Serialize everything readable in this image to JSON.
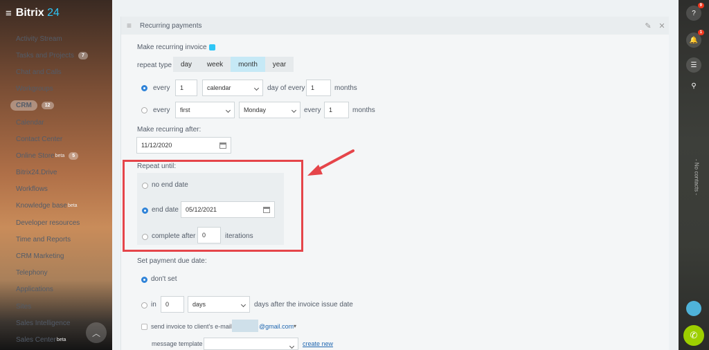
{
  "app": {
    "logo_main": "Bitrix",
    "logo_accent": "24"
  },
  "sidebar": {
    "items": [
      {
        "label": "Activity Stream"
      },
      {
        "label": "Tasks and Projects",
        "counter": "7"
      },
      {
        "label": "Chat and Calls"
      },
      {
        "label": "Workgroups"
      },
      {
        "label": "CRM",
        "counter": "12",
        "active": true
      },
      {
        "label": "Calendar"
      },
      {
        "label": "Contact Center"
      },
      {
        "label": "Online Store",
        "sup": "beta",
        "counter": "5"
      },
      {
        "label": "Bitrix24.Drive"
      },
      {
        "label": "Workflows"
      },
      {
        "label": "Knowledge base",
        "sup": "beta"
      },
      {
        "label": "Developer resources"
      },
      {
        "label": "Time and Reports"
      },
      {
        "label": "CRM Marketing"
      },
      {
        "label": "Telephony"
      },
      {
        "label": "Applications"
      },
      {
        "label": "Sites"
      },
      {
        "label": "Sales Intelligence"
      },
      {
        "label": "Sales Center",
        "sup": "beta"
      }
    ]
  },
  "panel": {
    "title": "Recurring payments",
    "make_recurring_label": "Make recurring invoice",
    "repeat_type_label": "repeat type",
    "repeat_types": [
      "day",
      "week",
      "month",
      "year"
    ],
    "selected_repeat_type": "month",
    "row1": {
      "every": "every",
      "value": "1",
      "mode": "calendar",
      "day_of_every": "day of every",
      "months_value": "1",
      "months": "months"
    },
    "row2": {
      "every": "every",
      "ordinal": "first",
      "weekday": "Monday",
      "every2": "every",
      "months_value": "1",
      "months": "months"
    },
    "make_after_label": "Make recurring after:",
    "make_after_date": "11/12/2020",
    "repeat_until_label": "Repeat until:",
    "no_end_date": "no end date",
    "end_date_label": "end date",
    "end_date_value": "05/12/2021",
    "complete_after": "complete after",
    "iterations_value": "0",
    "iterations": "iterations",
    "due_date_label": "Set payment due date:",
    "dont_set": "don't set",
    "in_label": "in",
    "in_value": "0",
    "in_unit": "days",
    "days_after": "days after the invoice issue date",
    "send_invoice": "send invoice to client's e-mail",
    "email_domain": "@gmail.com",
    "message_template": "message template",
    "create_new": "create new"
  },
  "rightbar": {
    "help_badge": "9",
    "notif_badge": "1",
    "no_contacts": "- No contacts -"
  },
  "colors": {
    "accent": "#2fc6f6",
    "highlight_box": "#e5454a",
    "radio_on": "#2f83d8"
  }
}
